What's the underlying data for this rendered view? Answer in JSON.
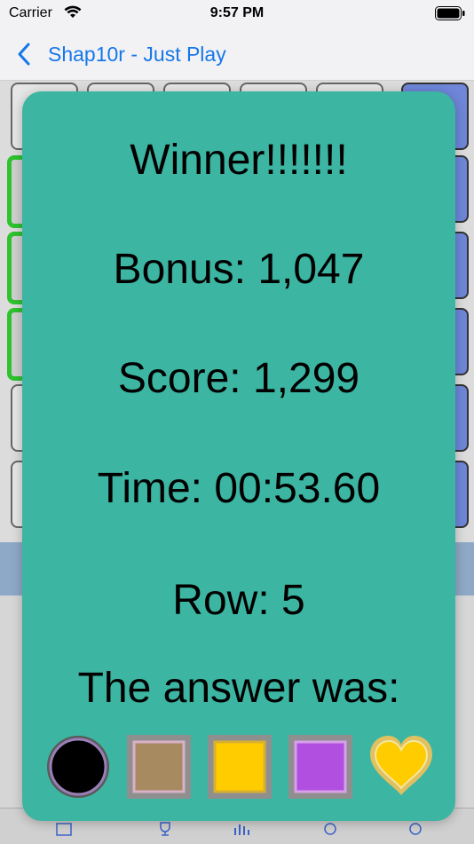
{
  "status_bar": {
    "carrier": "Carrier",
    "time": "9:57 PM"
  },
  "nav": {
    "back_title": "Shap10r - Just Play"
  },
  "dialog": {
    "winner": "Winner!!!!!!!",
    "bonus": "Bonus: 1,047",
    "score": "Score: 1,299",
    "time": "Time: 00:53.60",
    "row": "Row: 5",
    "answer_label": "The answer was:"
  },
  "answer": [
    {
      "shape": "circle-icon",
      "fill": "#000000",
      "border": "#9a7fb8"
    },
    {
      "shape": "square-icon",
      "fill": "#a88a60",
      "border": "#d8b0c8"
    },
    {
      "shape": "square-icon",
      "fill": "#ffcc00",
      "border": "#d8b030"
    },
    {
      "shape": "square-icon",
      "fill": "#b150e0",
      "border": "#d8a0e8"
    },
    {
      "shape": "heart-icon",
      "fill": "#ffcc00",
      "border": "#e0c060"
    }
  ],
  "colors": {
    "dialog": "#3cb5a2",
    "nav_tint": "#1677e8"
  }
}
